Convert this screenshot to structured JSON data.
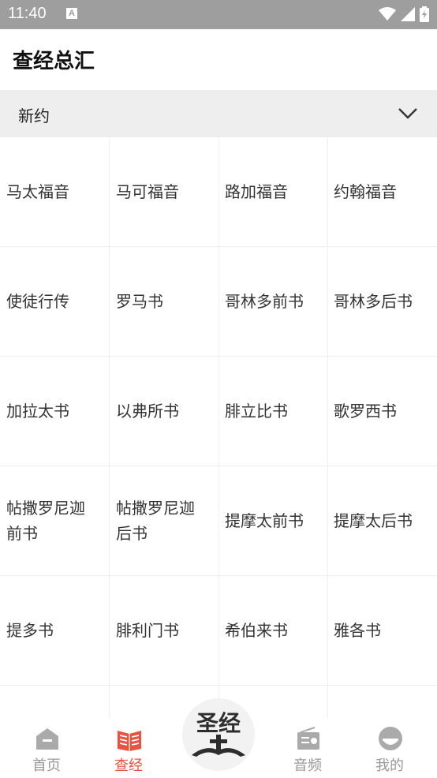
{
  "status": {
    "time": "11:40",
    "a_icon": "A"
  },
  "header": {
    "title": "查经总汇"
  },
  "dropdown": {
    "selected": "新约"
  },
  "books": [
    "马太福音",
    "马可福音",
    "路加福音",
    "约翰福音",
    "使徒行传",
    "罗马书",
    "哥林多前书",
    "哥林多后书",
    "加拉太书",
    "以弗所书",
    "腓立比书",
    "歌罗西书",
    "帖撒罗尼迦前书",
    "帖撒罗尼迦后书",
    "提摩太前书",
    "提摩太后书",
    "提多书",
    "腓利门书",
    "希伯来书",
    "雅各书",
    "",
    "",
    "",
    ""
  ],
  "tabs": [
    {
      "label": "首页",
      "icon": "home-icon"
    },
    {
      "label": "查经",
      "icon": "book-icon",
      "active": true
    },
    {
      "label": "圣经",
      "icon": "bible-logo-icon"
    },
    {
      "label": "音频",
      "icon": "radio-icon"
    },
    {
      "label": "我的",
      "icon": "profile-icon"
    }
  ],
  "colors": {
    "accent": "#e8523e",
    "inactive": "#999999",
    "dropdown_bg": "#eeeeee",
    "statusbar": "#9e9e9e"
  }
}
